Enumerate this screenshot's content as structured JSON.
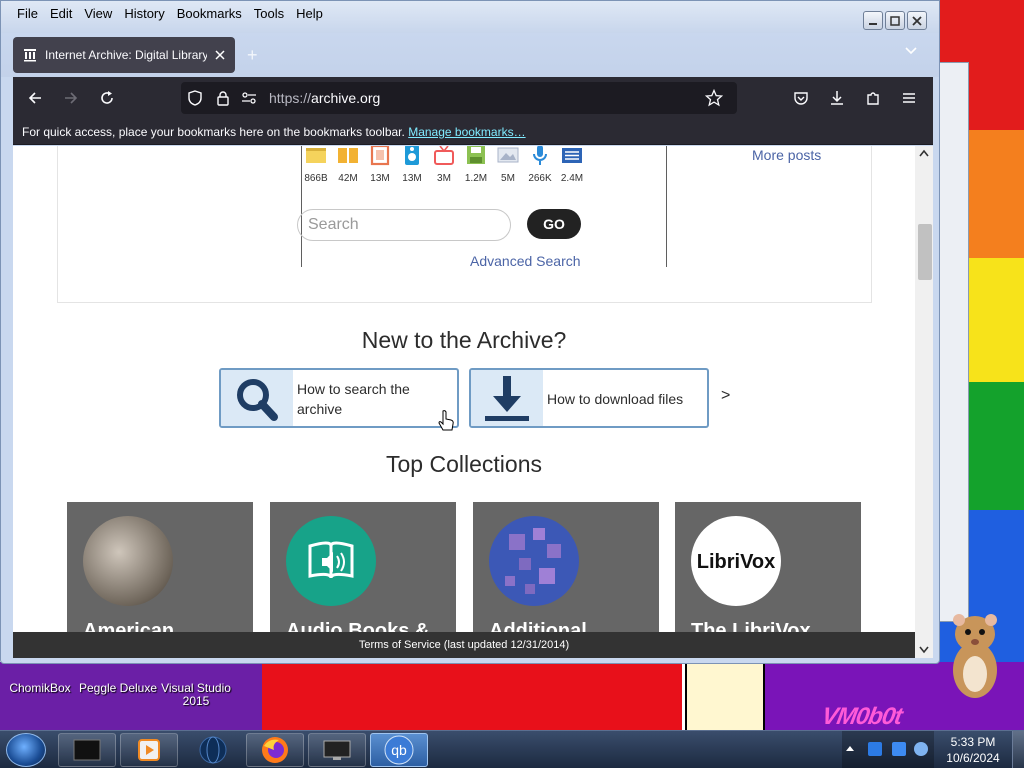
{
  "window": {
    "title": "Internet Archive: Digital Library"
  },
  "menubar": {
    "items": [
      "File",
      "Edit",
      "View",
      "History",
      "Bookmarks",
      "Tools",
      "Help"
    ]
  },
  "tabs": [
    {
      "label": "Internet Archive: Digital Library"
    }
  ],
  "navbar": {
    "url_prefix": "https://",
    "url_host": "archive.org"
  },
  "bookmarks_bar": {
    "message": "For quick access, place your bookmarks here on the bookmarks toolbar.",
    "link": "Manage bookmarks…"
  },
  "page": {
    "media_types": [
      {
        "name": "web-icon",
        "count": "866B",
        "color": "#f5d35c"
      },
      {
        "name": "texts-icon",
        "count": "42M",
        "color": "#f2b233"
      },
      {
        "name": "video-icon",
        "count": "13M",
        "color": "#e8764f"
      },
      {
        "name": "audio-icon",
        "count": "13M",
        "color": "#1e9ad8"
      },
      {
        "name": "tv-icon",
        "count": "3M",
        "color": "#f05a5a"
      },
      {
        "name": "software-icon",
        "count": "1.2M",
        "color": "#8cc152"
      },
      {
        "name": "images-icon",
        "count": "5M",
        "color": "#a8b3c8"
      },
      {
        "name": "microphone-icon",
        "count": "266K",
        "color": "#2a8ad8"
      },
      {
        "name": "list-icon",
        "count": "2.4M",
        "color": "#2d64b6"
      }
    ],
    "search_placeholder": "Search",
    "go_label": "GO",
    "advanced_search": "Advanced Search",
    "more_posts": "More posts",
    "new_heading": "New to the Archive?",
    "howto": [
      {
        "label": "How to search the archive"
      },
      {
        "label": "How to download files"
      }
    ],
    "howto_next": ">",
    "collections_heading": "Top Collections",
    "collections": [
      {
        "title": "American"
      },
      {
        "title": "Audio Books &"
      },
      {
        "title": "Additional"
      },
      {
        "title": "The LibriVox"
      }
    ],
    "librivox_logo_text": "LibriVox",
    "tos": "Terms of Service (last updated 12/31/2014)"
  },
  "desktop": {
    "icons": [
      "ChomikBox",
      "Peggle Deluxe",
      "Visual Studio 2015"
    ],
    "wallpaper_text": "VM0b0t"
  },
  "taskbar": {
    "time": "5:33 PM",
    "date": "10/6/2024",
    "apps": [
      "terminal-icon",
      "media-player-icon",
      "globe-icon",
      "firefox-icon",
      "monitor-icon",
      "qbittorrent-icon"
    ],
    "qb_label": "qb"
  }
}
